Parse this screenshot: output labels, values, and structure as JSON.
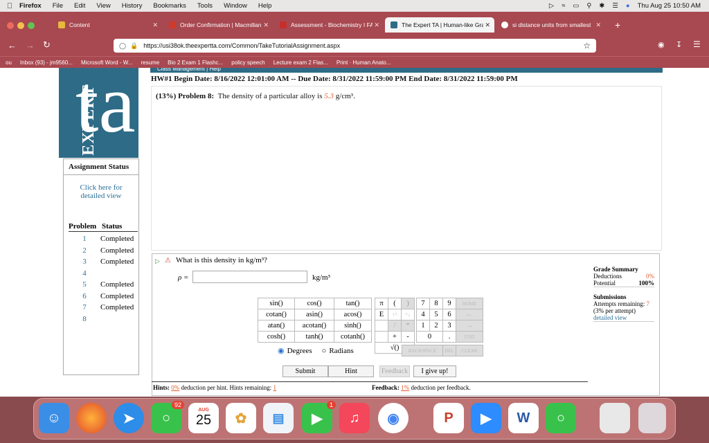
{
  "menubar": {
    "app": "Firefox",
    "items": [
      "File",
      "Edit",
      "View",
      "History",
      "Bookmarks",
      "Tools",
      "Window",
      "Help"
    ],
    "datetime": "Thu Aug 25  10:50 AM"
  },
  "tabs": [
    {
      "label": "Content"
    },
    {
      "label": "Order Confirmation | Macmillan"
    },
    {
      "label": "Assessment - Biochemistry I FA"
    },
    {
      "label": "The Expert TA | Human-like Gra"
    },
    {
      "label": "si distance units from smallest"
    }
  ],
  "url": "https://usi38ok.theexpertta.com/Common/TakeTutorialAssignment.aspx",
  "bookmarks": [
    "ou",
    "Inbox (93) - jm9560...",
    "Microsoft Word - W...",
    "resume",
    "Bio 2 Exam 1 Flashc...",
    "policy speech",
    "Lecture exam 2 Flas...",
    "Print · Human Anato..."
  ],
  "page": {
    "nav_partial": "Class Management  |  Help",
    "header_line": "HW#1 Begin Date: 8/16/2022 12:01:00 AM -- Due Date: 8/31/2022 11:59:00 PM End Date: 8/31/2022 11:59:00 PM",
    "problem_weight": "(13%)",
    "problem_label": "Problem 8:",
    "problem_text": "The density of a particular alloy is",
    "density_value": "5.3",
    "density_unit": "g/cm³.",
    "logo_vertical": "EXPERT",
    "logo_ta": "ta"
  },
  "sidebar": {
    "title": "Assignment Status",
    "link": "Click here for detailed view",
    "col_problem": "Problem",
    "col_status": "Status",
    "rows": [
      {
        "num": "1",
        "status": "Completed"
      },
      {
        "num": "2",
        "status": "Completed"
      },
      {
        "num": "3",
        "status": "Completed"
      },
      {
        "num": "4",
        "status": ""
      },
      {
        "num": "5",
        "status": "Completed"
      },
      {
        "num": "6",
        "status": "Completed"
      },
      {
        "num": "7",
        "status": "Completed"
      },
      {
        "num": "8",
        "status": ""
      }
    ]
  },
  "question": {
    "text": "What is this density in kg/m³?",
    "symbol": "ρ =",
    "unit": "kg/m³",
    "input_value": ""
  },
  "keypad": {
    "functions": [
      [
        "sin()",
        "cos()",
        "tan()"
      ],
      [
        "cotan()",
        "asin()",
        "acos()"
      ],
      [
        "atan()",
        "acotan()",
        "sinh()"
      ],
      [
        "cosh()",
        "tanh()",
        "cotanh()"
      ]
    ],
    "symbols": [
      [
        "π",
        "(",
        ")"
      ],
      [
        "E",
        "↑^",
        "^↓"
      ],
      [
        "",
        "/",
        "*"
      ],
      [
        "",
        "+",
        "-"
      ]
    ],
    "digits": [
      [
        "7",
        "8",
        "9",
        "HOME"
      ],
      [
        "4",
        "5",
        "6",
        "←"
      ],
      [
        "1",
        "2",
        "3",
        "→"
      ],
      [
        "0",
        "",
        ".",
        "END"
      ]
    ],
    "sqrt": "√()",
    "backspace": "BACKSPACE",
    "del": "DEL",
    "clear": "CLEAR",
    "degrees": "Degrees",
    "radians": "Radians"
  },
  "buttons": {
    "submit": "Submit",
    "hint": "Hint",
    "feedback": "Feedback",
    "give_up": "I give up!"
  },
  "grade": {
    "title": "Grade Summary",
    "deductions_label": "Deductions",
    "deductions_value": "0%",
    "potential_label": "Potential",
    "potential_value": "100%",
    "submissions_title": "Submissions",
    "attempts_label": "Attempts remaining:",
    "attempts_value": "7",
    "per_attempt": "(3% per attempt)",
    "detailed": "detailed view"
  },
  "hints": {
    "label": "Hints:",
    "pct": "0%",
    "text": "deduction per hint. Hints remaining:",
    "remaining": "1"
  },
  "feedback": {
    "label": "Feedback:",
    "pct": "1%",
    "text": "deduction per feedback."
  },
  "dock": {
    "messages_badge": "92",
    "facetime_badge": "1",
    "calendar_month": "AUG",
    "calendar_day": "25"
  }
}
